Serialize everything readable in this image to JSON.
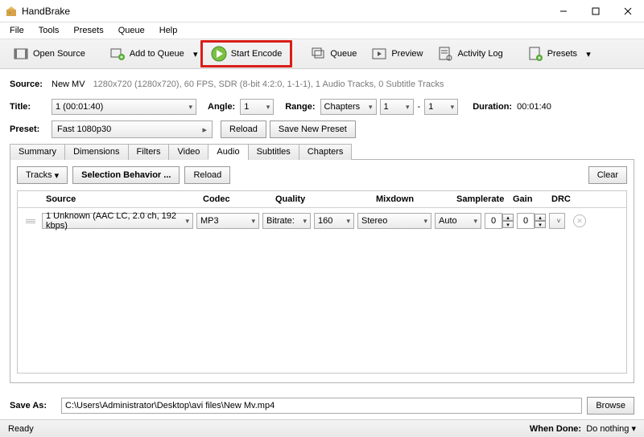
{
  "app": {
    "title": "HandBrake"
  },
  "menu": {
    "items": [
      "File",
      "Tools",
      "Presets",
      "Queue",
      "Help"
    ]
  },
  "toolbar": {
    "open_source": "Open Source",
    "add_to_queue": "Add to Queue",
    "start_encode": "Start Encode",
    "queue": "Queue",
    "preview": "Preview",
    "activity_log": "Activity Log",
    "presets": "Presets"
  },
  "source": {
    "label": "Source:",
    "name": "New MV",
    "info": "1280x720 (1280x720), 60 FPS, SDR (8-bit 4:2:0, 1-1-1), 1 Audio Tracks, 0 Subtitle Tracks"
  },
  "title": {
    "label": "Title:",
    "value": "1  (00:01:40)",
    "angle_label": "Angle:",
    "angle": "1",
    "range_label": "Range:",
    "range_type": "Chapters",
    "range_from": "1",
    "range_dash": "-",
    "range_to": "1",
    "duration_label": "Duration:",
    "duration": "00:01:40"
  },
  "preset": {
    "label": "Preset:",
    "value": "Fast 1080p30",
    "reload": "Reload",
    "save_new": "Save New Preset"
  },
  "tabs": [
    "Summary",
    "Dimensions",
    "Filters",
    "Video",
    "Audio",
    "Subtitles",
    "Chapters"
  ],
  "active_tab": "Audio",
  "audio_panel": {
    "tracks_btn": "Tracks",
    "selection_behavior_btn": "Selection Behavior ...",
    "reload_btn": "Reload",
    "clear_btn": "Clear",
    "columns": {
      "source": "Source",
      "codec": "Codec",
      "quality": "Quality",
      "mixdown": "Mixdown",
      "samplerate": "Samplerate",
      "gain": "Gain",
      "drc": "DRC"
    },
    "row": {
      "source": "1 Unknown (AAC LC, 2.0 ch, 192 kbps)",
      "codec": "MP3",
      "quality_mode": "Bitrate:",
      "bitrate": "160",
      "mixdown": "Stereo",
      "samplerate": "Auto",
      "gain": "0",
      "drc": "0"
    }
  },
  "saveas": {
    "label": "Save As:",
    "path": "C:\\Users\\Administrator\\Desktop\\avi files\\New Mv.mp4",
    "browse": "Browse"
  },
  "status": {
    "ready": "Ready",
    "when_done_label": "When Done:",
    "when_done": "Do nothing"
  }
}
